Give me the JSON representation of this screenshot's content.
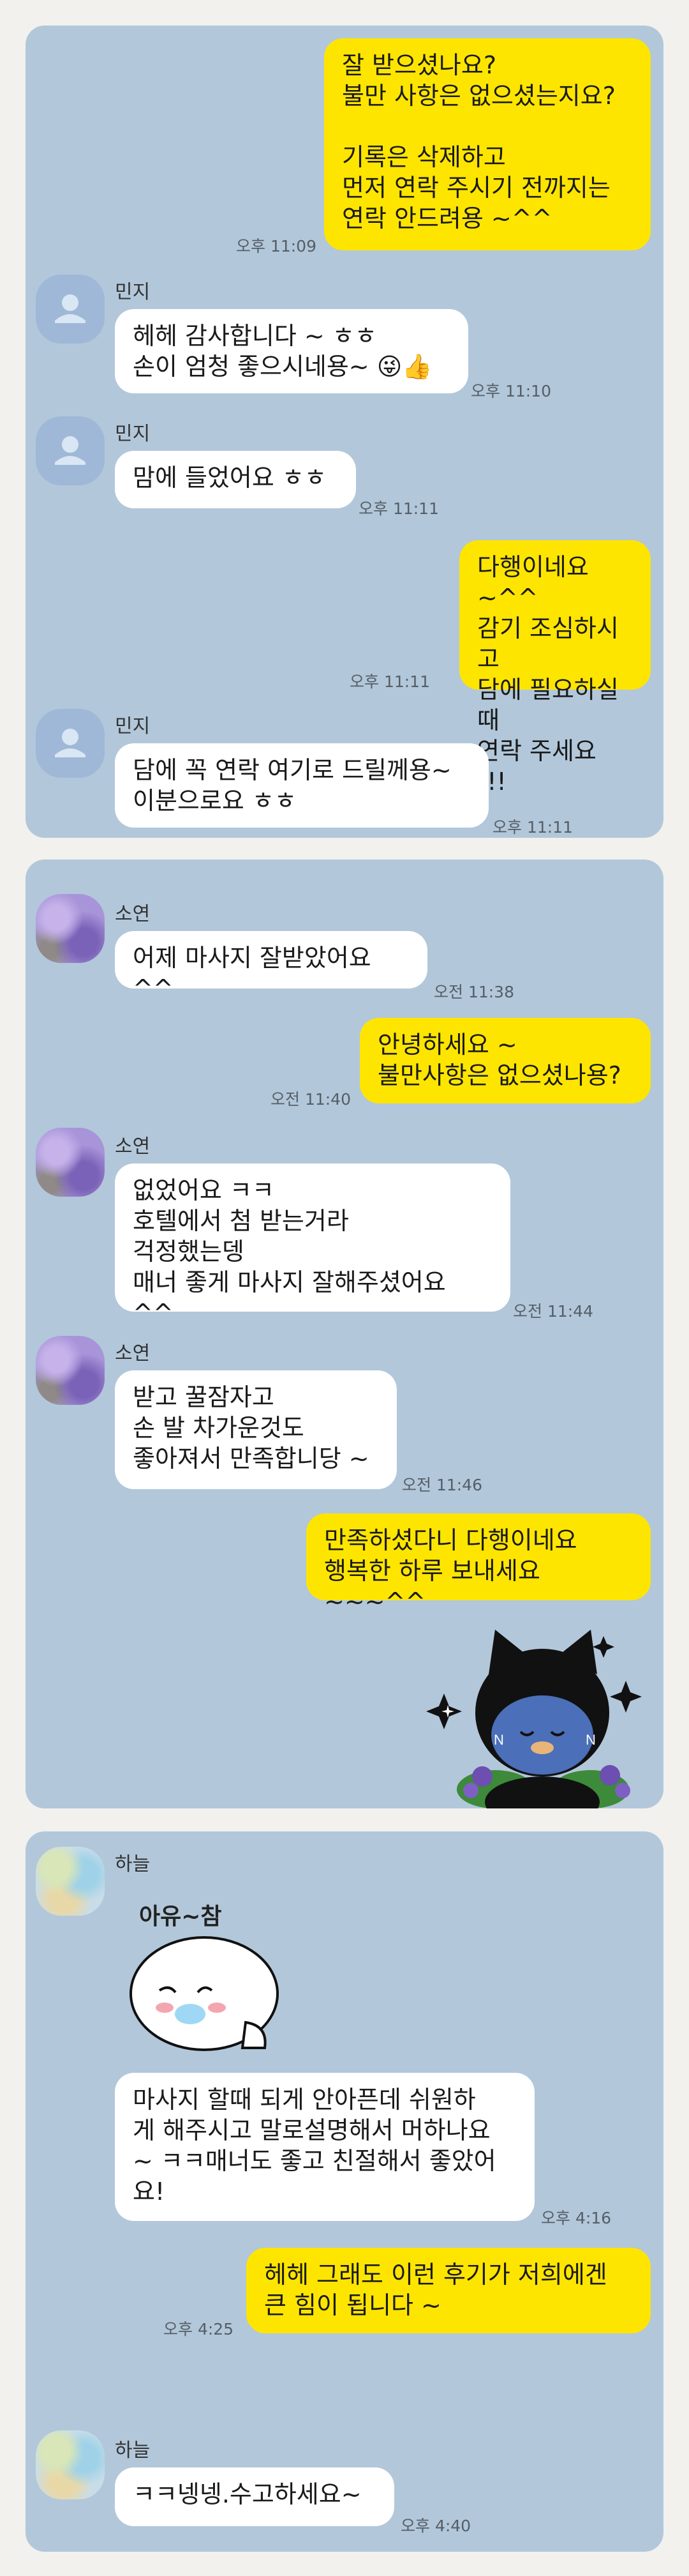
{
  "panel1": {
    "msg1": {
      "text": "잘 받으셨나요?\n불만 사항은 없으셨는지요?\n\n기록은 삭제하고\n먼저 연락 주시기 전까지는\n연락 안드려용 ~^^",
      "time": "오후 11:09"
    },
    "msg2": {
      "sender": "민지",
      "text": "헤헤 감사합니다 ~ ㅎㅎ\n손이 엄청 좋으시네용~ 😜👍",
      "time": "오후 11:10"
    },
    "msg3": {
      "sender": "민지",
      "text": "맘에 들었어요 ㅎㅎ",
      "time": "오후 11:11"
    },
    "msg4": {
      "text": "다행이네요 ~^^\n감기 조심하시고\n담에 필요하실때\n연락 주세요 !!!",
      "time": "오후 11:11"
    },
    "msg5": {
      "sender": "민지",
      "text": "담에 꼭 연락 여기로 드릴께용~\n이분으로요 ㅎㅎ",
      "time": "오후 11:11"
    }
  },
  "panel2": {
    "msg1": {
      "sender": "소연",
      "text": "어제 마사지 잘받았어요 ^^",
      "time": "오전 11:38"
    },
    "msg2": {
      "text": "안녕하세요 ~\n불만사항은 없으셨나용?",
      "time": "오전 11:40"
    },
    "msg3": {
      "sender": "소연",
      "text": "없었어요 ㅋㅋ\n호텔에서 첨 받는거라\n걱정했는뎅\n매너 좋게 마사지 잘해주셨어요 ^^",
      "time": "오전 11:44"
    },
    "msg4": {
      "sender": "소연",
      "text": "받고 꿀잠자고\n손 발 차가운것도\n좋아져서 만족합니당 ~",
      "time": "오전 11:46"
    },
    "msg5": {
      "text": "만족하셨다니 다행이네요\n행복한 하루 보내세요 ~~~^^"
    }
  },
  "panel3": {
    "msg1": {
      "sender": "하늘",
      "sticker_text": "아유~참",
      "text": "마사지 할때 되게 안아픈데 쉬원하\n게 해주시고 말로설명해서 머하나요\n~ ㅋㅋ매너도 좋고 친절해서 좋았어\n요!",
      "time": "오후 4:16"
    },
    "msg2": {
      "text": "헤헤 그래도 이런 후기가 저희에겐\n큰 힘이 됩니다 ~",
      "time": "오후 4:25"
    },
    "msg3": {
      "sender": "하늘",
      "text": "ㅋㅋ넹넹.수고하세요~",
      "time": "오후 4:40"
    }
  },
  "colors": {
    "chat_background": "#b2c7da",
    "my_bubble": "#fee500",
    "other_bubble": "#ffffff",
    "page_background": "#f2f1ee"
  },
  "icons": {
    "default_avatar": "person-silhouette-icon",
    "sticker_cat": "black-cat-sticker",
    "sticker_blob": "white-blob-sticker"
  }
}
